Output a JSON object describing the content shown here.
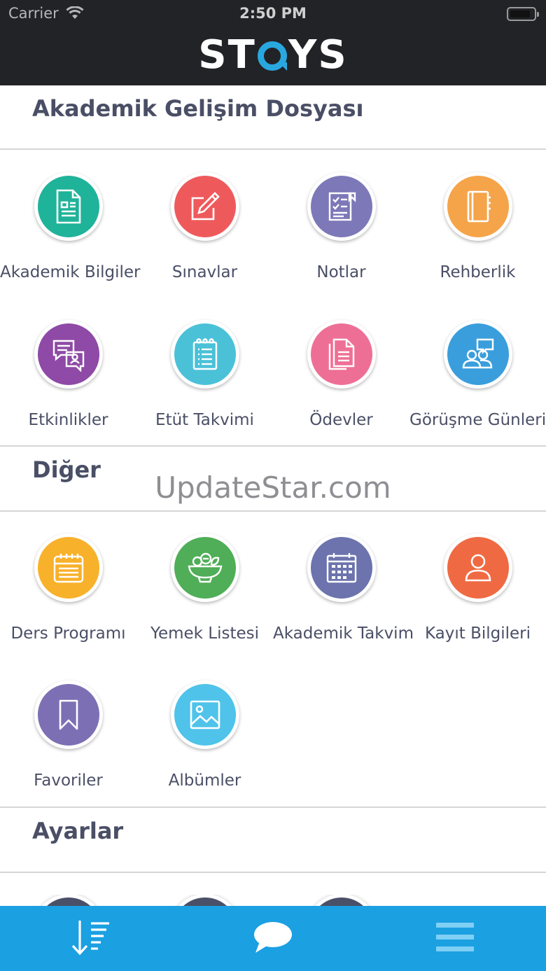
{
  "status_bar": {
    "carrier": "Carrier",
    "time": "2:50 PM"
  },
  "header": {
    "logo_text_left": "ST",
    "logo_text_right": "YS"
  },
  "sections": [
    {
      "title": "Akademik Gelişim Dosyası",
      "items": [
        {
          "label": "Akademik Bilgiler",
          "icon": "document-icon",
          "color": "#1fb39a"
        },
        {
          "label": "Sınavlar",
          "icon": "edit-icon",
          "color": "#ee5a5c"
        },
        {
          "label": "Notlar",
          "icon": "checklist-icon",
          "color": "#7d78b8"
        },
        {
          "label": "Rehberlik",
          "icon": "notebook-icon",
          "color": "#f5a44a"
        },
        {
          "label": "Etkinlikler",
          "icon": "chat-bubbles-icon",
          "color": "#8e4aa6"
        },
        {
          "label": "Etüt Takvimi",
          "icon": "notepad-icon",
          "color": "#4bc1d8"
        },
        {
          "label": "Ödevler",
          "icon": "papers-icon",
          "color": "#ee6f96"
        },
        {
          "label": "Görüşme Günleri",
          "icon": "meeting-icon",
          "color": "#3a9edc"
        }
      ]
    },
    {
      "title": "Diğer",
      "items": [
        {
          "label": "Ders Programı",
          "icon": "schedule-icon",
          "color": "#f8b12a"
        },
        {
          "label": "Yemek Listesi",
          "icon": "salad-bowl-icon",
          "color": "#4fae57"
        },
        {
          "label": "Akademik Takvim",
          "icon": "calendar-icon",
          "color": "#6c73ad"
        },
        {
          "label": "Kayıt Bilgileri",
          "icon": "user-icon",
          "color": "#ef6a43"
        },
        {
          "label": "Favoriler",
          "icon": "bookmark-icon",
          "color": "#7d6fb4"
        },
        {
          "label": "Albümler",
          "icon": "image-icon",
          "color": "#4fc3ea"
        }
      ]
    },
    {
      "title": "Ayarlar",
      "items": []
    }
  ],
  "watermark": "UpdateStar.com",
  "tab_bar": {
    "color": "#1ba0e2",
    "tabs": [
      {
        "icon": "sort-list-icon"
      },
      {
        "icon": "chat-icon"
      },
      {
        "icon": "menu-icon"
      }
    ]
  }
}
